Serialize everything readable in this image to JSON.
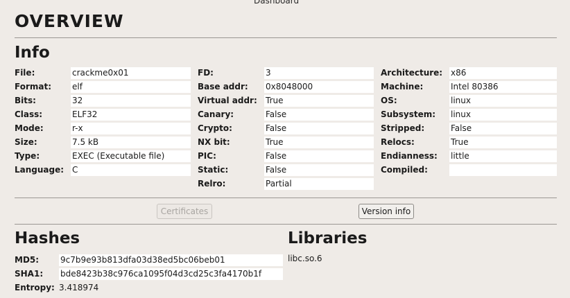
{
  "tab": {
    "label": "Dashboard"
  },
  "page": {
    "title": "OVERVIEW"
  },
  "info": {
    "title": "Info",
    "col1": [
      {
        "label": "File:",
        "value": "crackme0x01"
      },
      {
        "label": "Format:",
        "value": "elf"
      },
      {
        "label": "Bits:",
        "value": "32"
      },
      {
        "label": "Class:",
        "value": "ELF32"
      },
      {
        "label": "Mode:",
        "value": "r-x"
      },
      {
        "label": "Size:",
        "value": "7.5 kB"
      },
      {
        "label": "Type:",
        "value": "EXEC (Executable file)"
      },
      {
        "label": "Language:",
        "value": "C"
      }
    ],
    "col2": [
      {
        "label": "FD:",
        "value": "3"
      },
      {
        "label": "Base addr:",
        "value": "0x8048000"
      },
      {
        "label": "Virtual addr:",
        "value": "True"
      },
      {
        "label": "Canary:",
        "value": "False"
      },
      {
        "label": "Crypto:",
        "value": "False"
      },
      {
        "label": "NX bit:",
        "value": "True"
      },
      {
        "label": "PIC:",
        "value": "False"
      },
      {
        "label": "Static:",
        "value": "False"
      },
      {
        "label": "Relro:",
        "value": "Partial"
      }
    ],
    "col3": [
      {
        "label": "Architecture:",
        "value": "x86"
      },
      {
        "label": "Machine:",
        "value": "Intel 80386"
      },
      {
        "label": "OS:",
        "value": "linux"
      },
      {
        "label": "Subsystem:",
        "value": "linux"
      },
      {
        "label": "Stripped:",
        "value": "False"
      },
      {
        "label": "Relocs:",
        "value": "True"
      },
      {
        "label": "Endianness:",
        "value": "little"
      },
      {
        "label": "Compiled:",
        "value": ""
      }
    ]
  },
  "buttons": {
    "certificates": "Certificates",
    "version_info": "Version info"
  },
  "hashes": {
    "title": "Hashes",
    "md5_label": "MD5:",
    "md5": "9c7b9e93b813dfa03d38ed5bc06beb01",
    "sha1_label": "SHA1:",
    "sha1": "bde8423b38c976ca1095f04d3cd25c3fa4170b1f",
    "entropy_label": "Entropy:",
    "entropy": "3.418974"
  },
  "libraries": {
    "title": "Libraries",
    "items": [
      "libc.so.6"
    ]
  }
}
